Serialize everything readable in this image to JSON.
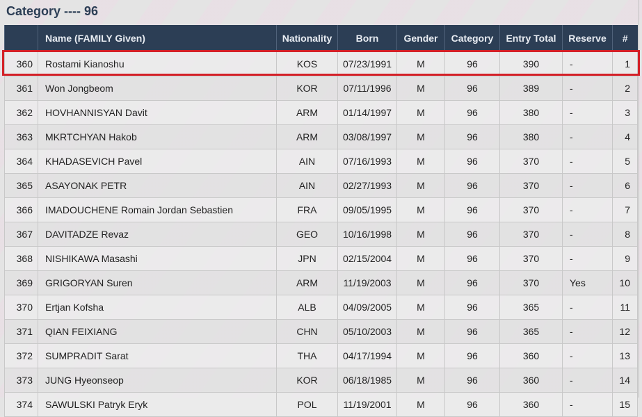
{
  "title": "Category ---- 96",
  "headers": [
    "",
    "Name (FAMILY Given)",
    "Nationality",
    "Born",
    "Gender",
    "Category",
    "Entry Total",
    "Reserve",
    "#"
  ],
  "rows": [
    [
      "360",
      "Rostami Kianoshu",
      "KOS",
      "07/23/1991",
      "M",
      "96",
      "390",
      "-",
      "1"
    ],
    [
      "361",
      "Won Jongbeom",
      "KOR",
      "07/11/1996",
      "M",
      "96",
      "389",
      "-",
      "2"
    ],
    [
      "362",
      "HOVHANNISYAN Davit",
      "ARM",
      "01/14/1997",
      "M",
      "96",
      "380",
      "-",
      "3"
    ],
    [
      "363",
      "MKRTCHYAN Hakob",
      "ARM",
      "03/08/1997",
      "M",
      "96",
      "380",
      "-",
      "4"
    ],
    [
      "364",
      "KHADASEVICH Pavel",
      "AIN",
      "07/16/1993",
      "M",
      "96",
      "370",
      "-",
      "5"
    ],
    [
      "365",
      "ASAYONAK PETR",
      "AIN",
      "02/27/1993",
      "M",
      "96",
      "370",
      "-",
      "6"
    ],
    [
      "366",
      "IMADOUCHENE Romain Jordan Sebastien",
      "FRA",
      "09/05/1995",
      "M",
      "96",
      "370",
      "-",
      "7"
    ],
    [
      "367",
      "DAVITADZE Revaz",
      "GEO",
      "10/16/1998",
      "M",
      "96",
      "370",
      "-",
      "8"
    ],
    [
      "368",
      "NISHIKAWA Masashi",
      "JPN",
      "02/15/2004",
      "M",
      "96",
      "370",
      "-",
      "9"
    ],
    [
      "369",
      "GRIGORYAN Suren",
      "ARM",
      "11/19/2003",
      "M",
      "96",
      "370",
      "Yes",
      "10"
    ],
    [
      "370",
      "Ertjan Kofsha",
      "ALB",
      "04/09/2005",
      "M",
      "96",
      "365",
      "-",
      "11"
    ],
    [
      "371",
      "QIAN FEIXIANG",
      "CHN",
      "05/10/2003",
      "M",
      "96",
      "365",
      "-",
      "12"
    ],
    [
      "372",
      "SUMPRADIT Sarat",
      "THA",
      "04/17/1994",
      "M",
      "96",
      "360",
      "-",
      "13"
    ],
    [
      "373",
      "JUNG Hyeonseop",
      "KOR",
      "06/18/1985",
      "M",
      "96",
      "360",
      "-",
      "14"
    ],
    [
      "374",
      "SAWULSKI Patryk Eryk",
      "POL",
      "11/19/2001",
      "M",
      "96",
      "360",
      "-",
      "15"
    ]
  ],
  "highlight_color": "#d42027"
}
